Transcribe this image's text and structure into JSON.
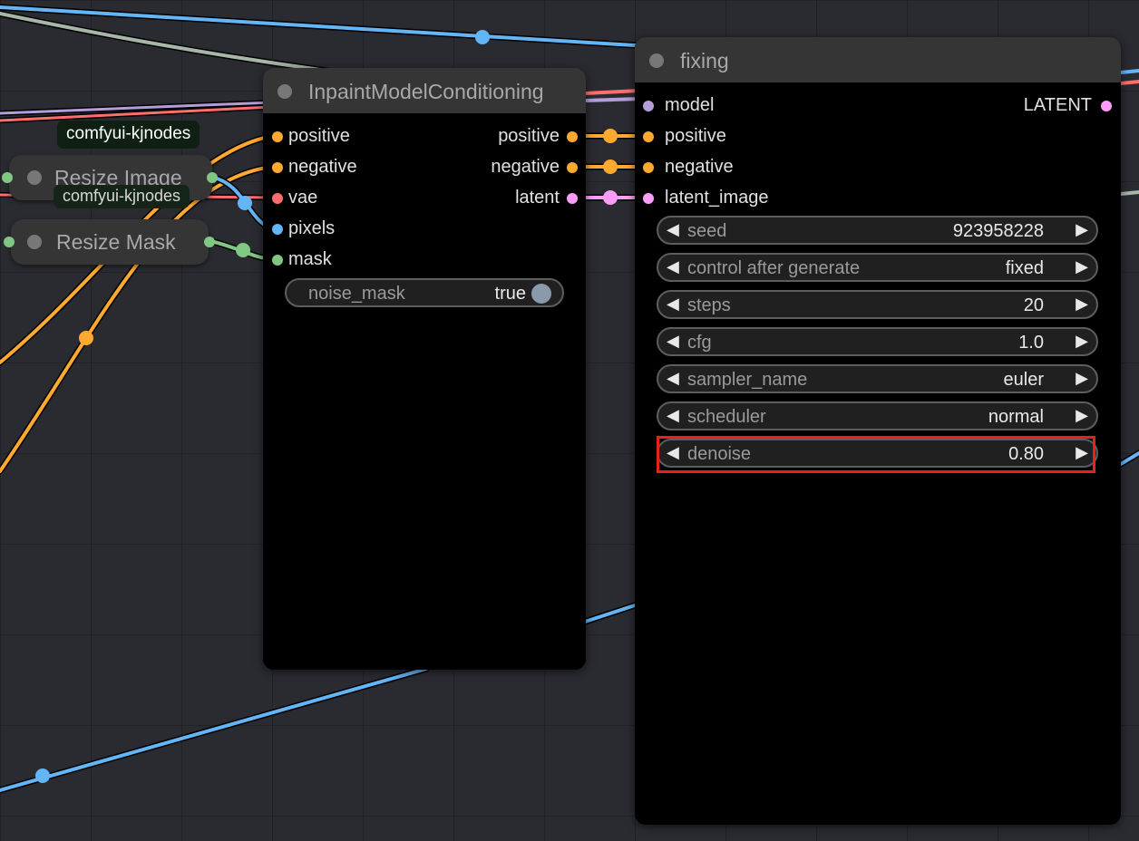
{
  "colors": {
    "model": "#b39ddb",
    "conditioning": "#ffa931",
    "vae": "#ff6e6e",
    "image": "#64b5f6",
    "mask": "#81c784",
    "latent": "#ff9cf9",
    "highlight": "#e8221a"
  },
  "group_tags": [
    "comfyui-kjnodes",
    "comfyui-kjnodes"
  ],
  "collapsed_nodes": {
    "resize_image": "Resize Image",
    "resize_mask": "Resize Mask"
  },
  "inpaint_node": {
    "title": "InpaintModelConditioning",
    "inputs": [
      "positive",
      "negative",
      "vae",
      "pixels",
      "mask"
    ],
    "outputs": [
      "positive",
      "negative",
      "latent"
    ],
    "toggle": {
      "name": "noise_mask",
      "value": "true"
    }
  },
  "sampler_node": {
    "title": "fixing",
    "inputs": [
      "model",
      "positive",
      "negative",
      "latent_image"
    ],
    "output": "LATENT",
    "widgets": [
      {
        "name": "seed",
        "value": "923958228"
      },
      {
        "name": "control after generate",
        "value": "fixed"
      },
      {
        "name": "steps",
        "value": "20"
      },
      {
        "name": "cfg",
        "value": "1.0"
      },
      {
        "name": "sampler_name",
        "value": "euler"
      },
      {
        "name": "scheduler",
        "value": "normal"
      },
      {
        "name": "denoise",
        "value": "0.80"
      }
    ],
    "highlighted_widget": "denoise"
  },
  "icons": {
    "decrement": "◀",
    "increment": "▶"
  }
}
